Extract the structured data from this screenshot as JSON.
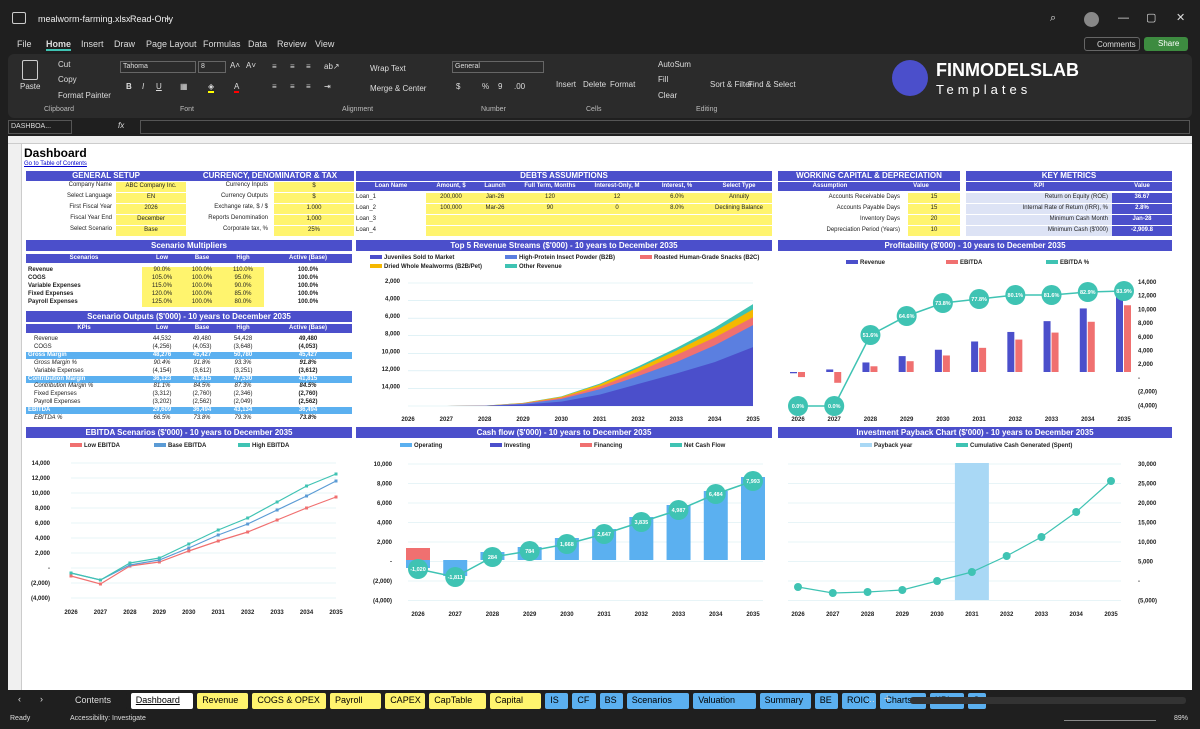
{
  "title_bar": {
    "file_name": "mealworm-farming.xlsx",
    "mode": "Read-Only"
  },
  "menu": [
    "File",
    "Home",
    "Insert",
    "Draw",
    "Page Layout",
    "Formulas",
    "Data",
    "Review",
    "View"
  ],
  "menu_active": "Home",
  "buttons": {
    "comments": "Comments",
    "share": "Share"
  },
  "ribbon": {
    "paste": "Paste",
    "cut": "Cut",
    "copy": "Copy",
    "format_painter": "Format Painter",
    "clipboard": "Clipboard",
    "font_name": "Tahoma",
    "font_size": "8",
    "font": "Font",
    "wrap_text": "Wrap Text",
    "merge": "Merge & Center",
    "alignment": "Alignment",
    "number_format": "General",
    "number": "Number",
    "insert": "Insert",
    "delete": "Delete",
    "format": "Format",
    "cells": "Cells",
    "autosum": "AutoSum",
    "fill": "Fill",
    "clear": "Clear",
    "sort": "Sort & Filter",
    "find": "Find & Select",
    "editing": "Editing",
    "logo_title": "FINMODELSLAB",
    "logo_sub": "Templates"
  },
  "formula": {
    "name_box": "DASHBOA...",
    "fx": "fx"
  },
  "dashboard": {
    "title": "Dashboard",
    "toc": "Go to Table of Contents",
    "general": {
      "header": "GENERAL SETUP",
      "rows": [
        [
          "Company Name",
          "ABC Company Inc."
        ],
        [
          "Select Language",
          "EN"
        ],
        [
          "First Fiscal Year",
          "2026"
        ],
        [
          "Fiscal Year End",
          "December"
        ],
        [
          "Select Scenario",
          "Base"
        ]
      ]
    },
    "currency": {
      "header": "CURRENCY, DENOMINATOR & TAX",
      "rows": [
        [
          "Currency Inputs",
          "$"
        ],
        [
          "Currency Outputs",
          "$"
        ],
        [
          "Exchange rate, $ / $",
          "1.000"
        ],
        [
          "Reports Denomination",
          "1,000"
        ],
        [
          "Corporate tax, %",
          "25%"
        ]
      ]
    },
    "debts": {
      "header": "DEBTS ASSUMPTIONS",
      "cols": [
        "Loan Name",
        "Amount, $",
        "Launch",
        "Full Term, Months",
        "Interest-Only, M",
        "Interest, %",
        "Select Type"
      ],
      "rows": [
        [
          "Loan_1",
          "200,000",
          "Jan-26",
          "120",
          "12",
          "6.0%",
          "Annuity"
        ],
        [
          "Loan_2",
          "100,000",
          "Mar-26",
          "90",
          "0",
          "8.0%",
          "Declining Balance"
        ],
        [
          "Loan_3",
          "",
          "",
          "",
          "",
          "",
          ""
        ],
        [
          "Loan_4",
          "",
          "",
          "",
          "",
          "",
          ""
        ]
      ]
    },
    "wc": {
      "header": "WORKING CAPITAL & DEPRECIATION",
      "cols": [
        "Assumption",
        "Value"
      ],
      "rows": [
        [
          "Accounts Receivable Days",
          "15"
        ],
        [
          "Accounts Payable Days",
          "15"
        ],
        [
          "Inventory Days",
          "20"
        ],
        [
          "Depreciation Period (Years)",
          "10"
        ]
      ]
    },
    "kpis": {
      "header": "KEY METRICS",
      "cols": [
        "KPI",
        "Value"
      ],
      "rows": [
        [
          "Return on Equity (ROE)",
          "36.67"
        ],
        [
          "Internal Rate of Return (IRR), %",
          "2.8%"
        ],
        [
          "Minimum Cash Month",
          "Jan-28"
        ],
        [
          "Minimum Cash ($'000)",
          "-2,909.8"
        ]
      ]
    },
    "multipliers": {
      "header": "Scenario Multipliers",
      "cols": [
        "Scenarios",
        "Low",
        "Base",
        "High",
        "Active (Base)"
      ],
      "rows": [
        [
          "Revenue",
          "90.0%",
          "100.0%",
          "110.0%",
          "100.0%"
        ],
        [
          "COGS",
          "105.0%",
          "100.0%",
          "95.0%",
          "100.0%"
        ],
        [
          "Variable Expenses",
          "115.0%",
          "100.0%",
          "90.0%",
          "100.0%"
        ],
        [
          "Fixed Expenses",
          "120.0%",
          "100.0%",
          "85.0%",
          "100.0%"
        ],
        [
          "Payroll Expenses",
          "125.0%",
          "100.0%",
          "80.0%",
          "100.0%"
        ]
      ]
    },
    "outputs": {
      "header": "Scenario Outputs ($'000) - 10 years to December 2035",
      "cols": [
        "KPIs",
        "Low",
        "Base",
        "High",
        "Active (Base)"
      ],
      "rows": [
        [
          "Revenue",
          "44,532",
          "49,480",
          "54,428",
          "49,480"
        ],
        [
          "COGS",
          "(4,256)",
          "(4,053)",
          "(3,648)",
          "(4,053)"
        ],
        [
          "Gross Margin",
          "48,276",
          "45,427",
          "50,780",
          "45,427"
        ],
        [
          "Gross Margin %",
          "90.4%",
          "91.8%",
          "93.3%",
          "91.8%"
        ],
        [
          "Variable Expenses",
          "(4,154)",
          "(3,612)",
          "(3,251)",
          "(3,612)"
        ],
        [
          "Contribution Margin",
          "36,123",
          "41,815",
          "47,530",
          "41,815"
        ],
        [
          "Contribution Margin %",
          "81.1%",
          "84.5%",
          "87.3%",
          "84.5%"
        ],
        [
          "Fixed Expenses",
          "(3,312)",
          "(2,760)",
          "(2,346)",
          "(2,760)"
        ],
        [
          "Payroll Expenses",
          "(3,202)",
          "(2,562)",
          "(2,049)",
          "(2,562)"
        ],
        [
          "EBITDA",
          "29,609",
          "36,494",
          "43,134",
          "36,494"
        ],
        [
          "EBITDA %",
          "66.5%",
          "73.8%",
          "79.3%",
          "73.8%"
        ]
      ]
    }
  },
  "chart_data": [
    {
      "type": "area",
      "title": "Top 5 Revenue Streams ($'000) - 10 years to December 2035",
      "categories": [
        "2026",
        "2027",
        "2028",
        "2029",
        "2030",
        "2031",
        "2032",
        "2033",
        "2034",
        "2035"
      ],
      "series": [
        {
          "name": "Juveniles Sold to Market",
          "color": "#4b4fcb"
        },
        {
          "name": "High-Protein Insect Powder (B2B)",
          "color": "#5b7fe0"
        },
        {
          "name": "Roasted Human-Grade Snacks (B2C)",
          "color": "#f07070"
        },
        {
          "name": "Dried Whole Mealworms (B2B/Pet)",
          "color": "#f5b800"
        },
        {
          "name": "Other Revenue",
          "color": "#3fc3b3"
        }
      ],
      "ylim": [
        0,
        14000
      ],
      "yticks": [
        "2,000",
        "4,000",
        "6,000",
        "8,000",
        "10,000",
        "12,000",
        "14,000"
      ]
    },
    {
      "type": "bar",
      "title": "Profitability ($'000) - 10 years to December 2035",
      "categories": [
        "2026",
        "2027",
        "2028",
        "2029",
        "2030",
        "2031",
        "2032",
        "2033",
        "2034",
        "2035"
      ],
      "series": [
        {
          "name": "Revenue",
          "color": "#4b4fcb",
          "values": [
            -200,
            400,
            1500,
            2500,
            3500,
            4800,
            6300,
            8000,
            10000,
            12000
          ]
        },
        {
          "name": "EBITDA",
          "color": "#f07070",
          "values": [
            -800,
            -1700,
            900,
            1700,
            2600,
            3800,
            5100,
            6200,
            7900,
            10500
          ]
        },
        {
          "name": "EBITDA %",
          "color": "#3fc3b3",
          "labels": [
            "0.0%",
            "0.0%",
            "51.6%",
            "64.6%",
            "73.8%",
            "77.8%",
            "80.1%",
            "81.6%",
            "82.9%",
            "83.9%"
          ]
        }
      ],
      "yticks": [
        "14,000",
        "12,000",
        "10,000",
        "8,000",
        "6,000",
        "4,000",
        "2,000",
        "-",
        "(2,000)",
        "(4,000)"
      ]
    },
    {
      "type": "line",
      "title": "EBITDA Scenarios ($'000) - 10 years to December 2035",
      "categories": [
        "2026",
        "2027",
        "2028",
        "2029",
        "2030",
        "2031",
        "2032",
        "2033",
        "2034",
        "2035"
      ],
      "series": [
        {
          "name": "Low EBITDA",
          "color": "#f07070"
        },
        {
          "name": "Base EBITDA",
          "color": "#5b9bd5"
        },
        {
          "name": "High EBITDA",
          "color": "#3fc3b3"
        }
      ],
      "yticks": [
        "14,000",
        "12,000",
        "10,000",
        "8,000",
        "6,000",
        "4,000",
        "2,000",
        "-",
        "(2,000)",
        "(4,000)"
      ]
    },
    {
      "type": "bar",
      "title": "Cash flow ($'000) - 10 years to December 2035",
      "categories": [
        "2026",
        "2027",
        "2028",
        "2029",
        "2030",
        "2031",
        "2032",
        "2033",
        "2034",
        "2035"
      ],
      "series": [
        {
          "name": "Operating",
          "color": "#5bb0f0"
        },
        {
          "name": "Investing",
          "color": "#4b4fcb"
        },
        {
          "name": "Financing",
          "color": "#f07070"
        },
        {
          "name": "Net Cash Flow",
          "color": "#3fc3b3",
          "labels": [
            "-1,020",
            "-1,811",
            "284",
            "784",
            "1,668",
            "2,647",
            "3,835",
            "4,987",
            "6,484",
            "7,993"
          ]
        }
      ],
      "yticks": [
        "10,000",
        "8,000",
        "6,000",
        "4,000",
        "2,000",
        "-",
        "(2,000)",
        "(4,000)"
      ]
    },
    {
      "type": "line",
      "title": "Investment Payback Chart ($'000) - 10 years to December 2035",
      "categories": [
        "2026",
        "2027",
        "2028",
        "2029",
        "2030",
        "2031",
        "2032",
        "2033",
        "2034",
        "2035"
      ],
      "series": [
        {
          "name": "Payback year",
          "color": "#a9d8f5"
        },
        {
          "name": "Cumulative Cash Generated (Spent)",
          "color": "#3fc3b3"
        }
      ],
      "yticks": [
        "30,000",
        "25,000",
        "20,000",
        "15,000",
        "10,000",
        "5,000",
        "-",
        "(5,000)"
      ]
    }
  ],
  "tabs": [
    {
      "label": "Contents",
      "color": "#1f1f1f",
      "fg": "#ddd"
    },
    {
      "label": "Dashboard",
      "color": "#ffffff",
      "fg": "#000"
    },
    {
      "label": "Revenue",
      "color": "#fff46e"
    },
    {
      "label": "COGS & OPEX",
      "color": "#fff46e"
    },
    {
      "label": "Payroll",
      "color": "#fff46e"
    },
    {
      "label": "CAPEX",
      "color": "#fff46e"
    },
    {
      "label": "CapTable",
      "color": "#fff46e"
    },
    {
      "label": "Capital",
      "color": "#fff46e"
    },
    {
      "label": "IS",
      "color": "#5bb0f0"
    },
    {
      "label": "CF",
      "color": "#5bb0f0"
    },
    {
      "label": "BS",
      "color": "#5bb0f0"
    },
    {
      "label": "Scenarios",
      "color": "#5bb0f0"
    },
    {
      "label": "Valuation",
      "color": "#5bb0f0"
    },
    {
      "label": "Summary",
      "color": "#5bb0f0"
    },
    {
      "label": "BE",
      "color": "#5bb0f0"
    },
    {
      "label": "ROIC",
      "color": "#5bb0f0"
    },
    {
      "label": "Charts",
      "color": "#5bb0f0"
    },
    {
      "label": "KPIs",
      "color": "#5bb0f0"
    },
    {
      "label": "S",
      "color": "#5bb0f0"
    }
  ],
  "status": {
    "ready": "Ready",
    "accessibility": "Accessibility: Investigate",
    "zoom": "89%"
  }
}
